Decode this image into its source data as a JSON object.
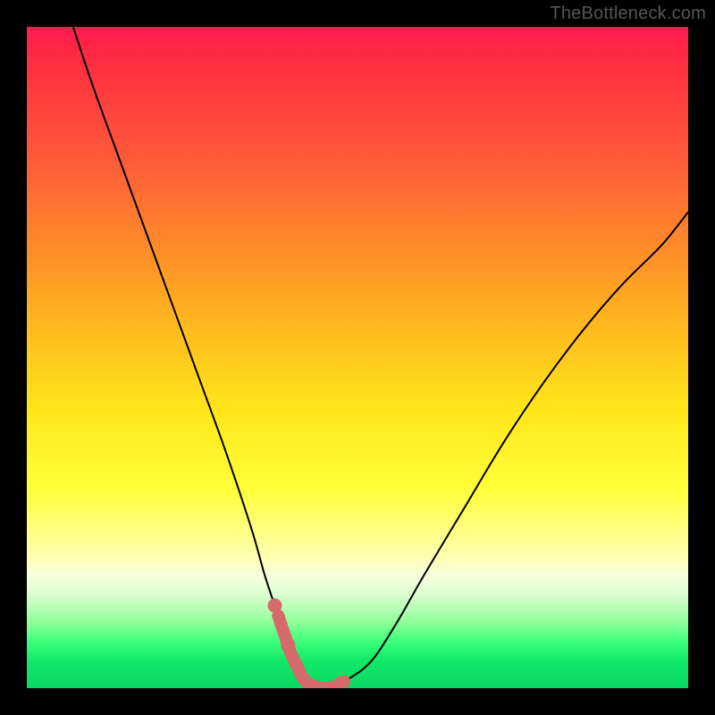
{
  "watermark": "TheBottleneck.com",
  "chart_data": {
    "type": "line",
    "title": "",
    "xlabel": "",
    "ylabel": "",
    "xlim": [
      0,
      100
    ],
    "ylim": [
      0,
      100
    ],
    "grid": false,
    "legend": false,
    "series": [
      {
        "name": "bottleneck-curve",
        "x": [
          7,
          10,
          14,
          18,
          22,
          26,
          30,
          34,
          36,
          38,
          40,
          42,
          44,
          46,
          48,
          52,
          56,
          60,
          66,
          72,
          78,
          84,
          90,
          96,
          100
        ],
        "values": [
          100,
          91,
          80,
          69,
          58,
          47,
          36,
          24,
          17,
          11,
          5,
          1,
          0,
          0,
          1,
          4,
          10,
          17,
          27,
          37,
          46,
          54,
          61,
          67,
          72
        ]
      }
    ],
    "annotations": {
      "optimal_band_x": [
        38,
        48
      ],
      "optimal_marker_points_x": [
        37.5,
        39.5,
        44,
        46,
        47.5
      ],
      "optimal_marker_color": "#d46a6a"
    }
  }
}
